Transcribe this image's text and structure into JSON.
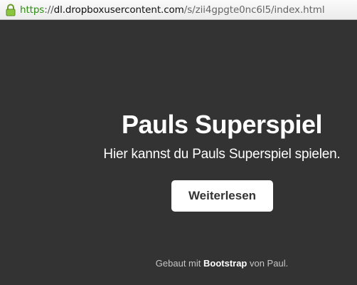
{
  "browser": {
    "url_scheme": "https",
    "url_separator": "://",
    "url_host": "dl.dropboxusercontent.com",
    "url_path": "/s/zii4gpgte0nc6l5/index.html",
    "lock_icon": "lock-icon",
    "scheme_color": "#2e8b12"
  },
  "hero": {
    "title": "Pauls Superspiel",
    "lead": "Hier kannst du Pauls Superspiel spielen.",
    "button_label": "Weiterlesen"
  },
  "footer": {
    "prefix": "Gebaut mit ",
    "link_text": "Bootstrap",
    "suffix": " von Paul."
  },
  "colors": {
    "background": "#333333",
    "text": "#ffffff",
    "button_bg": "#ffffff",
    "button_text": "#333333",
    "footer_text": "#c5c5c5"
  }
}
